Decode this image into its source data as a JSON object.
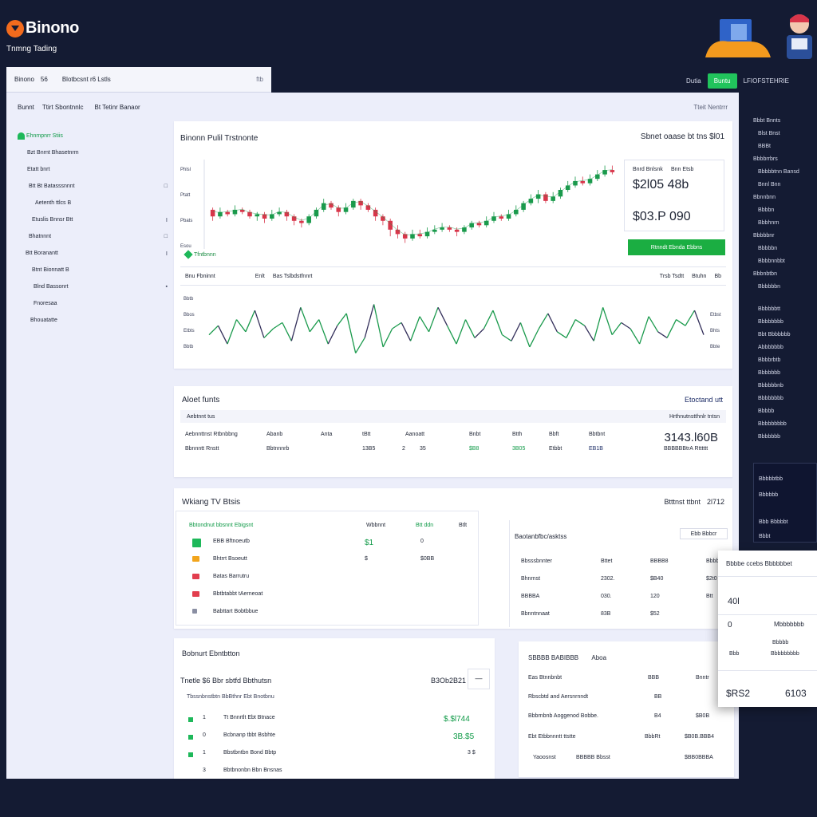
{
  "brand": {
    "name": "Binono",
    "tagline": "Tnmng Tading",
    "accent_color": "#f26b1d"
  },
  "topbar": {
    "left": [
      "Binono",
      "56",
      "Blotbcsnt r6 Lstls",
      "ftb"
    ],
    "right_link": "Dutia",
    "right_button": "Buntu",
    "right_text": "LFIOFSTEHRIE"
  },
  "main_header": {
    "items": [
      "Bunnt",
      "Ttirt Sbontnnlc",
      "Bt Tetinr Banaor"
    ],
    "right": "Tteit Nentrrr"
  },
  "sidebar": {
    "items": [
      {
        "label": "Ehnmpnrr Stiis",
        "tail": ""
      },
      {
        "label": "Bzt Bnrnt Bhasetnrm",
        "tail": ""
      },
      {
        "label": "Etatt bnrt",
        "tail": ""
      },
      {
        "label": "Btt Bt Batasssnnnt",
        "tail": "□"
      },
      {
        "label": "Aetenth ttlcs B",
        "tail": ""
      },
      {
        "label": "Etuslis Bnnsr Btt",
        "tail": "Ⅰ"
      },
      {
        "label": "Bhatnnnt",
        "tail": "□"
      },
      {
        "label": "Btt Boranantt",
        "tail": "Ⅰ"
      },
      {
        "label": "Btnt Bionnatt B",
        "tail": ""
      },
      {
        "label": "Blnd Bassonrt",
        "tail": "▪"
      },
      {
        "label": "Fnoresaa",
        "tail": ""
      },
      {
        "label": "Bhouatatte",
        "tail": ""
      }
    ]
  },
  "chart_panel": {
    "title": "Binonn Pulil Trstnonte",
    "title_right": "Sbnet oaase bt tns $l01",
    "yticks": [
      "Phlsl",
      "Ptatt",
      "Pbats",
      "Esou"
    ],
    "price_box": {
      "label_left": "Bnrd Bnlsnk",
      "label_right": "Bnn Etsb",
      "value_top": "$2l05  48b",
      "value_bottom": "$03.P  090"
    },
    "buy_button": "Rtnndt Ebnda Ebbns",
    "chip": "Tfntbnnn",
    "toolbar": [
      "Bnu Fbninnt",
      "Enlt",
      "Bas Tslbdstfnnrt"
    ],
    "toolbar_right": [
      "Trsb Tsdtt",
      "Btuhn",
      "Bb"
    ],
    "line_yticks": [
      "Bbtb",
      "Bbos",
      "Etbts",
      "Bbtb"
    ],
    "line_yticks_right": [
      "Etbst",
      "Bhts",
      "Bbte"
    ],
    "candle_color_up": "#1a9a4c",
    "candle_color_down": "#d8354a",
    "line_color": "#1a9a4c",
    "line_color_dark": "#34305b"
  },
  "transactions": {
    "title": "Aloet funts",
    "link": "Etoctand utt",
    "sub_left": "Aebtnnt tus",
    "sub_right": "Hrthnutnstthnlr tntsn",
    "rows": [
      [
        "Aebnnttnst Rtbnbbng",
        "Abanb",
        "Anta",
        "tBtt",
        "Aanoatt",
        "Bnbt",
        "Btth",
        "Bbft",
        "Bbtbnt"
      ],
      [
        "Bbnnntt Rnstt",
        "Bbtnnnrb",
        "13B5",
        "2",
        "35",
        "$B8",
        "3B05",
        "Etbbt",
        "EB1B"
      ]
    ],
    "big_value": "3143.l60B",
    "row2_tail": "BBBBBBtrA Rtttttt"
  },
  "watchlist": {
    "title": "Wkiang TV Btsis",
    "header_right_label": "Btttnst ttbnt",
    "header_right_value": "2l712",
    "col_headers": [
      "Bbtondnut bbsnnt Ebigsnt",
      "Wbbnnt",
      "Btt ddn",
      "Btlt"
    ],
    "rows": [
      {
        "name": "EBB Bftnoeutb",
        "v1": "$1",
        "v2": "0",
        "icon_color": "#1eb85a"
      },
      {
        "name": "Bhtrrt Bsoeutt",
        "v1": "$",
        "v2": "$0BB",
        "icon_color": "#f2a51d"
      },
      {
        "name": "Batas Barrutru",
        "v1": "",
        "v2": "",
        "icon_color": "#e23e4e"
      },
      {
        "name": "Bbtbtabbt tAerneoat",
        "v1": "",
        "v2": "",
        "icon_color": "#e23e4e"
      },
      {
        "name": "Babttart Bobtbbue",
        "v1": "",
        "v2": "",
        "icon_color": "#8a8fa3"
      }
    ],
    "market": {
      "title": "Baotanbfbc/asktss",
      "button": "Ebb Bbbcr",
      "rows": [
        [
          "Bbsssbnnter",
          "Bttet",
          "BBBB8",
          "Bbbbt"
        ],
        [
          "Bhnrnst",
          "2302.",
          "$B40",
          "$2t0"
        ],
        [
          "BBBBA",
          "030.",
          "120",
          "Btt"
        ],
        [
          "Bbnntnnaat",
          "83B",
          "$52",
          ""
        ]
      ]
    }
  },
  "recent": {
    "title": "Bobnurt Ebntbtton",
    "sub_left": "Tnetle $6 Bbr sbtfd Bbthutsn",
    "sub_right": "B3Ob2B21",
    "corner": "—",
    "band": "Tbssnbnstbtn BbBthnr Ebt Bnotbnu",
    "rows": [
      {
        "n": "1",
        "label": "Tt Bnnrtlt Ebt Btnace",
        "value": "$.$l744"
      },
      {
        "n": "0",
        "label": "Bcbnanp tbbt Bsbhte",
        "value": "3B.$5"
      },
      {
        "n": "1",
        "label": "Bbstbntbn Bond Bbtp",
        "value": "3 $"
      },
      {
        "n": "3",
        "label": "Bbtbnonbn Bbn Bnsnas",
        "value": ""
      }
    ]
  },
  "summary": {
    "title": "SBBBB BABIBBB",
    "title2": "Aboa",
    "rows": [
      [
        "Eas Btnnbnbt",
        "BBB",
        "Bnntr"
      ],
      [
        "Rbscbtd and Aersnrnndt",
        "BB",
        ""
      ],
      [
        "Bbbrnbnb Aoggenod Bobbe.",
        "B4",
        "$B0B"
      ],
      [
        "Ebt Etbbnnntt ttstte",
        "BbbRt",
        "$B0B.BBB4"
      ],
      [
        "Yaoosnst",
        "BBBBB Bbsst",
        "$BB0BBBA"
      ]
    ]
  },
  "right_column": [
    "Bbbt Bnnts",
    "Blst Bnst",
    "BBBt",
    "Bbbbrrbrs",
    "Bbbbbtnn Bansd",
    "Bnnl Bnn",
    "Bbnnbnn",
    "Bbbbn",
    "Bbbhnrn",
    "Bbbbbnr",
    "Bbbbbn",
    "Bbbbnnbbt",
    "Bbbnbtbn",
    "Bbbbbbn"
  ],
  "right_column_lower": [
    "Bbbbbbtt",
    "Bbbbbbbb",
    "Bbt Bbbbbbb",
    "Abbbbbbb",
    "Bbbbrbtb",
    "Bbbbbbb",
    "Bbbbbbnb",
    "Bbbbbbbb",
    "Bbbbb",
    "Bbbbbbbbb",
    "Bbbbbbb"
  ],
  "right_panel": [
    "Bbbbbtbb",
    "Bbbbbb",
    "Bbb Bbbbbt",
    "Bbbt"
  ],
  "float_panel": {
    "title": "Bbbbe ccebs Bbbbbbet",
    "v1": "40l",
    "v2": "0",
    "v3": "Mbbbbbbb",
    "small": [
      "Bbbbb",
      "Bbbbbbbbb",
      "Bbb"
    ],
    "v4": "$RS2",
    "v5": "6103"
  },
  "candles": [
    [
      110,
      104,
      112,
      100
    ],
    [
      104,
      108,
      112,
      102
    ],
    [
      108,
      106,
      110,
      104
    ],
    [
      106,
      110,
      114,
      104
    ],
    [
      110,
      108,
      112,
      106
    ],
    [
      108,
      104,
      110,
      102
    ],
    [
      104,
      106,
      108,
      100
    ],
    [
      106,
      102,
      108,
      98
    ],
    [
      102,
      106,
      110,
      100
    ],
    [
      106,
      108,
      112,
      104
    ],
    [
      108,
      104,
      110,
      100
    ],
    [
      104,
      100,
      106,
      96
    ],
    [
      100,
      98,
      102,
      94
    ],
    [
      98,
      104,
      106,
      96
    ],
    [
      104,
      110,
      112,
      102
    ],
    [
      110,
      116,
      120,
      108
    ],
    [
      116,
      112,
      118,
      110
    ],
    [
      112,
      108,
      114,
      104
    ],
    [
      108,
      112,
      116,
      106
    ],
    [
      112,
      118,
      120,
      110
    ],
    [
      118,
      114,
      120,
      110
    ],
    [
      114,
      110,
      116,
      108
    ],
    [
      110,
      104,
      112,
      100
    ],
    [
      104,
      100,
      106,
      96
    ],
    [
      100,
      92,
      102,
      86
    ],
    [
      92,
      88,
      96,
      84
    ],
    [
      88,
      84,
      90,
      80
    ],
    [
      84,
      88,
      92,
      82
    ],
    [
      88,
      86,
      92,
      84
    ],
    [
      86,
      90,
      94,
      84
    ],
    [
      90,
      92,
      96,
      88
    ],
    [
      92,
      94,
      98,
      90
    ],
    [
      94,
      92,
      96,
      90
    ],
    [
      92,
      90,
      94,
      86
    ],
    [
      90,
      94,
      96,
      88
    ],
    [
      94,
      98,
      100,
      92
    ],
    [
      98,
      96,
      100,
      94
    ],
    [
      96,
      100,
      104,
      94
    ],
    [
      100,
      104,
      108,
      98
    ],
    [
      104,
      102,
      106,
      100
    ],
    [
      102,
      106,
      110,
      100
    ],
    [
      106,
      110,
      114,
      104
    ],
    [
      110,
      116,
      118,
      108
    ],
    [
      116,
      120,
      124,
      114
    ],
    [
      120,
      124,
      128,
      116
    ],
    [
      124,
      118,
      126,
      116
    ],
    [
      118,
      122,
      126,
      116
    ],
    [
      122,
      128,
      130,
      120
    ],
    [
      128,
      132,
      136,
      126
    ],
    [
      132,
      136,
      140,
      130
    ],
    [
      136,
      134,
      140,
      132
    ],
    [
      134,
      138,
      142,
      132
    ],
    [
      138,
      142,
      146,
      136
    ],
    [
      142,
      146,
      150,
      140
    ],
    [
      146,
      144,
      150,
      142
    ]
  ],
  "line_points": [
    42,
    48,
    36,
    52,
    44,
    58,
    40,
    46,
    50,
    38,
    60,
    44,
    52,
    36,
    48,
    56,
    30,
    40,
    62,
    34,
    46,
    50,
    38,
    54,
    44,
    60,
    48,
    36,
    52,
    40,
    46,
    58,
    42,
    38,
    50,
    34,
    46,
    56,
    44,
    40,
    52,
    48,
    38,
    60,
    42,
    50,
    46,
    36,
    54,
    44,
    40,
    52,
    48,
    58,
    42
  ]
}
